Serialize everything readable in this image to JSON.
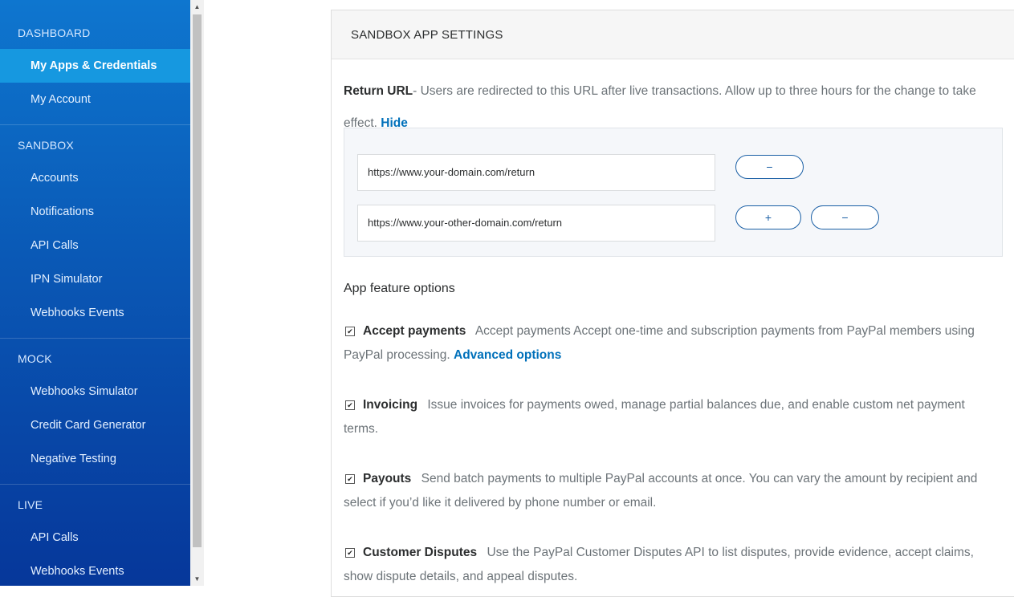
{
  "sidebar": {
    "dashboard_label": "DASHBOARD",
    "dashboard_items": [
      "My Apps & Credentials",
      "My Account"
    ],
    "sandbox_label": "SANDBOX",
    "sandbox_items": [
      "Accounts",
      "Notifications",
      "API Calls",
      "IPN Simulator",
      "Webhooks Events"
    ],
    "mock_label": "MOCK",
    "mock_items": [
      "Webhooks Simulator",
      "Credit Card Generator",
      "Negative Testing"
    ],
    "live_label": "LIVE",
    "live_items": [
      "API Calls",
      "Webhooks Events"
    ]
  },
  "panel": {
    "title": "SANDBOX APP SETTINGS",
    "return_url_label": "Return URL",
    "return_url_desc": "- Users are redirected to this URL after live transactions. Allow up to three hours for the change to take effect.",
    "hide_link": "Hide",
    "urls": [
      "https://www.your-domain.com/return",
      "https://www.your-other-domain.com/return"
    ],
    "minus_label": "−",
    "plus_label": "+",
    "features_title": "App feature options",
    "features": [
      {
        "name": "Accept payments",
        "desc": "Accept payments Accept one-time and subscription payments from PayPal members using PayPal processing.",
        "link": "Advanced options"
      },
      {
        "name": "Invoicing",
        "desc": "Issue invoices for payments owed, manage partial balances due, and enable custom net payment terms."
      },
      {
        "name": "Payouts",
        "desc": "Send batch payments to multiple PayPal accounts at once. You can vary the amount by recipient and select if you’d like it delivered by phone number or email."
      },
      {
        "name": "Customer Disputes",
        "desc": "Use the PayPal Customer Disputes API to list disputes, provide evidence, accept claims, show dispute details, and appeal disputes."
      }
    ],
    "checkbox_glyph": "✔"
  },
  "colors": {
    "link": "#0070ba",
    "sidebar_active": "#1698e0",
    "pill_border": "#1a5fa5"
  }
}
